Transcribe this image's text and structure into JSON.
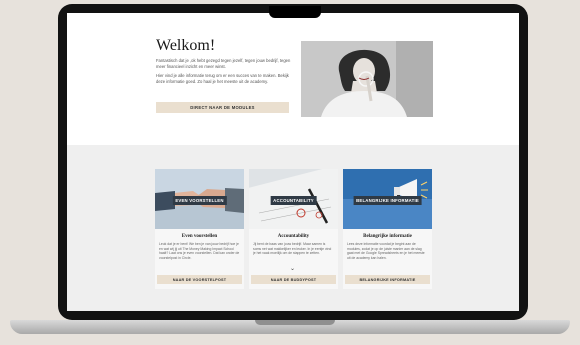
{
  "hero": {
    "title": "Welkom!",
    "intro_p1": "Fantastisch dat je ,ok hebt gezegd tegen jezelf, tegen jouw bedrijf, tegen meer financieel inzicht en meer winst.",
    "intro_p2": "Hier vind je alle informatie terug om er een succes van te maken. Bekijk deze informatie goed. Zo haal je het meeste uit de academy.",
    "cta_label": "DIRECT NAAR DE MODULES"
  },
  "cards": [
    {
      "badge": "EVEN VOORSTELLEN",
      "title": "Even voorstellen",
      "description": "Leuk dat je er bent! We ben je van jouw bedrijf hoe je en wat wij jij uit The Money Making Impact School haalt? Laat ons je even voorstellen. Dat kan onder de voorstelpost in Circle.",
      "button": "NAAR DE VOORSTELPOST"
    },
    {
      "badge": "ACCOUNTABILITY",
      "title": "Accountability",
      "description": "Jij bent de baas van jouw bedrijf. Maar samen is soms net wat makkelijker en leuker. In je eentje vind je het vaak moeilijk om de stappen te zetten.",
      "button": "NAAR DE BUDDYPOST"
    },
    {
      "badge": "BELANGRIJKE INFORMATIE",
      "title": "Belangrijke informatie",
      "description": "Lees deze informatie voordat je begint aan de modules, zodat je op de juiste manier aan de slag gaat met de Google Spreadsheets en je het meeste uit de academy kan halen.",
      "button": "BELANGRIJKE INFORMATIE"
    }
  ]
}
